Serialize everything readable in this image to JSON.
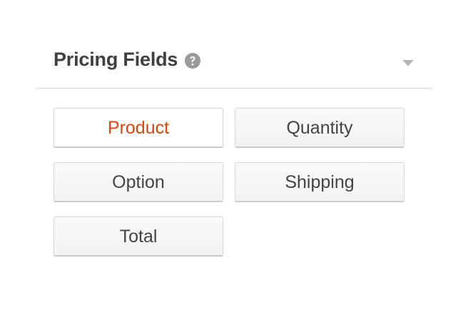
{
  "panel": {
    "title": "Pricing Fields",
    "help_icon": "question-circle-icon",
    "toggle_icon": "caret-down-icon"
  },
  "buttons": [
    {
      "label": "Product",
      "active": true
    },
    {
      "label": "Quantity",
      "active": false
    },
    {
      "label": "Option",
      "active": false
    },
    {
      "label": "Shipping",
      "active": false
    },
    {
      "label": "Total",
      "active": false
    }
  ],
  "colors": {
    "active_text": "#d5490f",
    "text": "#444444",
    "title": "#3f3f3f",
    "icon": "#999999"
  }
}
